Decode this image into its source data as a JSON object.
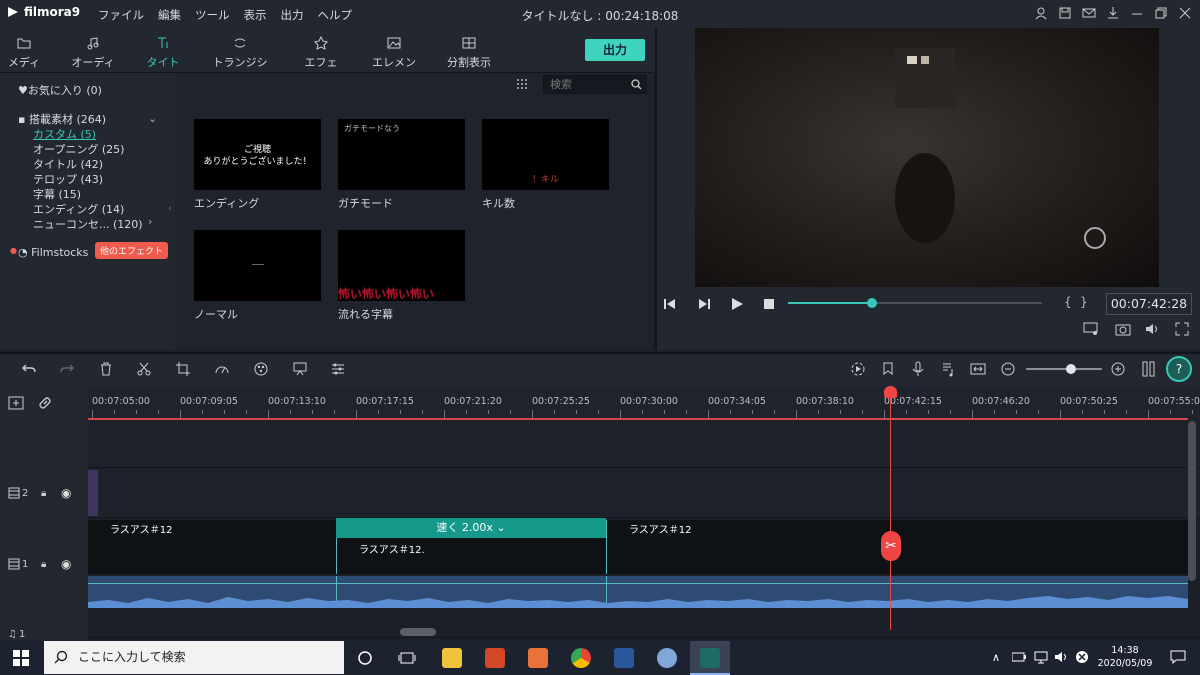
{
  "app": {
    "logo": "filmora9",
    "window_title": "タイトルなし : 00:24:18:08"
  },
  "menu": [
    "ファイル",
    "編集",
    "ツール",
    "表示",
    "出力",
    "ヘルプ"
  ],
  "tabs": [
    {
      "label": "メディア",
      "icon": "folder-icon"
    },
    {
      "label": "オーディオ",
      "icon": "music-note-icon"
    },
    {
      "label": "タイトル",
      "icon": "text-icon"
    },
    {
      "label": "トランジション",
      "icon": "transition-icon"
    },
    {
      "label": "エフェクト",
      "icon": "effects-icon"
    },
    {
      "label": "エレメント",
      "icon": "image-icon"
    },
    {
      "label": "分割表示",
      "icon": "split-screen-icon"
    }
  ],
  "export_label": "出力",
  "library": {
    "favorites": "お気に入り (0)",
    "builtin": "搭載素材 (264)",
    "items": [
      "カスタム (5)",
      "オープニング (25)",
      "タイトル (42)",
      "テロップ (43)",
      "字幕 (15)",
      "エンディング (14)",
      "ニューコンセ... (120)"
    ],
    "filmstocks": "Filmstocks",
    "more_effects": "他のエフェクト"
  },
  "search": {
    "placeholder": "検索"
  },
  "titles": [
    {
      "label": "エンディング",
      "text": "ご視聴\nありがとうございました！"
    },
    {
      "label": "ガチモード",
      "text": "ガチモードなう"
    },
    {
      "label": "キル数",
      "text": "！キル"
    },
    {
      "label": "ノーマル",
      "text": ""
    },
    {
      "label": "流れる字幕",
      "text": "怖い怖い怖い怖い"
    }
  ],
  "preview": {
    "timecode": "00:07:42:28",
    "progress": 0.33
  },
  "ruler_ticks": [
    "00:07:05:00",
    "00:07:09:05",
    "00:07:13:10",
    "00:07:17:15",
    "00:07:21:20",
    "00:07:25:25",
    "00:07:30:00",
    "00:07:34:05",
    "00:07:38:10",
    "00:07:42:15",
    "00:07:46:20",
    "00:07:50:25",
    "00:07:55:0"
  ],
  "tracks": {
    "video2": "2",
    "video1": "1",
    "audio1": "1"
  },
  "clips": {
    "clip_a": "ラスアス＃12",
    "clip_b": "ラスアス＃12.",
    "clip_c": "ラスアス＃12",
    "speed": "速く 2.00x"
  },
  "taskbar": {
    "search_text": "ここに入力して検索",
    "time": "14:38",
    "date": "2020/05/09"
  },
  "colors": {
    "accent": "#38c7b8",
    "playhead": "#f04545",
    "export": "#3fd4bd"
  }
}
